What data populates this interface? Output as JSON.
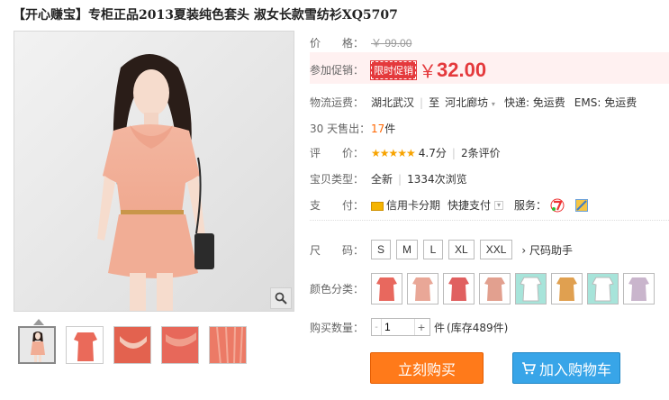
{
  "product": {
    "title": "【开心赚宝】专柜正品2013夏装纯色套头 淑女长款雪纺衫XQ5707"
  },
  "price": {
    "label": "价　　格：",
    "original": "￥ 99.00",
    "promo_label": "参加促销：",
    "promo_badge": "限时促销",
    "currency": "￥",
    "value": "32.00"
  },
  "shipping": {
    "label": "物流运费：",
    "from": "湖北武汉",
    "divider": "至",
    "to": "河北廊坊",
    "express": "快递: 免运费",
    "ems": "EMS: 免运费"
  },
  "sales": {
    "label": "30 天售出：",
    "count": "17",
    "unit": "件"
  },
  "rating": {
    "label": "评　　价：",
    "stars": "★★★★★",
    "score": "4.7分",
    "reviews": "2条评价",
    "rating_value": 4.7
  },
  "item_type": {
    "label": "宝贝类型：",
    "condition": "全新",
    "views": "1334次浏览"
  },
  "payment": {
    "label": "支　　付：",
    "credit": "信用卡分期",
    "quick": "快捷支付",
    "service_label": "服务："
  },
  "size": {
    "label": "尺　　码：",
    "options": [
      "S",
      "M",
      "L",
      "XL",
      "XXL"
    ],
    "guide": "尺码助手"
  },
  "color": {
    "label": "颜色分类：",
    "swatches": [
      "#e8685e",
      "#e9a797",
      "#e06060",
      "#e2a08f",
      "#ffffff",
      "#e0a050",
      "#ffffff",
      "#c9b5cc"
    ],
    "swatch_bg": [
      "#ffffff",
      "#ffffff",
      "#ffffff",
      "#ffffff",
      "#a7e4da",
      "#ffffff",
      "#a7e4da",
      "#ffffff"
    ]
  },
  "quantity": {
    "label": "购买数量：",
    "value": "1",
    "unit": "件",
    "stock": "(库存489件)"
  },
  "actions": {
    "buy_now": "立刻购买",
    "add_cart": "加入购物车"
  },
  "colors": {
    "accent_red": "#e4393c",
    "buy_orange": "#ff7a1a",
    "cart_blue": "#38a5e8"
  }
}
